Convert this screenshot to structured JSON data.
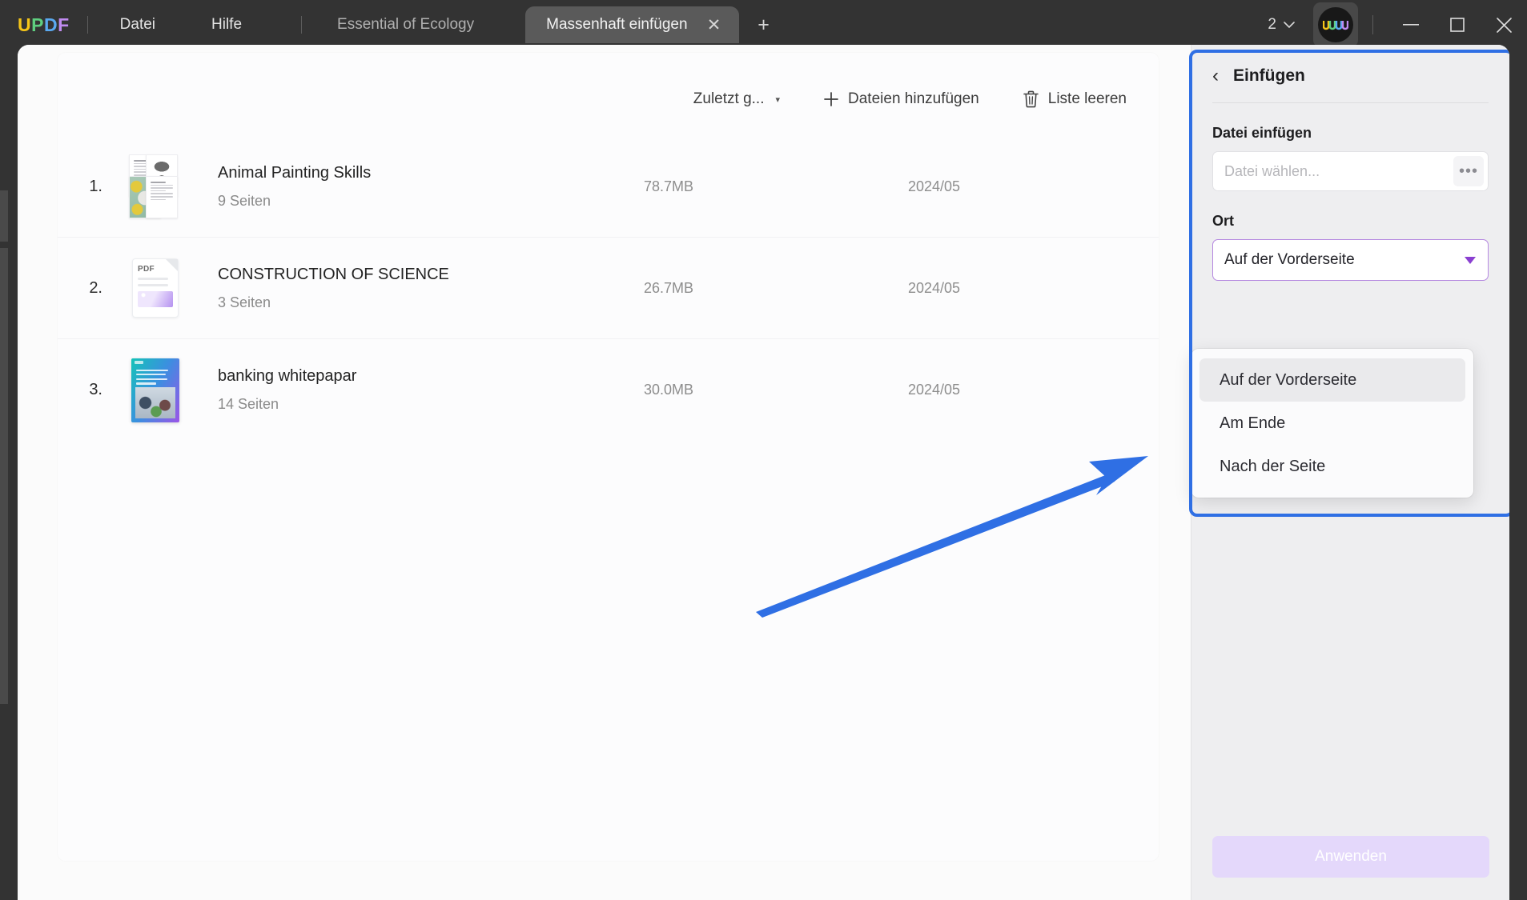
{
  "titlebar": {
    "logo_letters": [
      "U",
      "P",
      "D",
      "F"
    ],
    "menus": [
      {
        "label": "Datei",
        "name": "menu-datei"
      },
      {
        "label": "Hilfe",
        "name": "menu-hilfe"
      }
    ],
    "document_tab_label": "Essential of Ecology",
    "active_tab_label": "Massenhaft einfügen",
    "close_tab_glyph": "✕",
    "new_tab_glyph": "+",
    "page_count": "2",
    "page_count_caret": "⌄",
    "minimize_glyph": "—",
    "maximize_glyph": "□",
    "close_glyph": "✕"
  },
  "toolbar": {
    "sort_label": "Zuletzt g...",
    "sort_caret": "▾",
    "add_files_icon": "+",
    "add_files_label": "Dateien hinzufügen",
    "clear_list_label": "Liste leeren"
  },
  "files": [
    {
      "index": "1.",
      "name": "Animal Painting Skills",
      "pages": "9 Seiten",
      "size": "78.7MB",
      "date": "2024/05",
      "thumb": "page-grid"
    },
    {
      "index": "2.",
      "name": "CONSTRUCTION OF SCIENCE",
      "pages": "3 Seiten",
      "size": "26.7MB",
      "date": "2024/05",
      "thumb": "pdf-icon",
      "pdf_label": "PDF"
    },
    {
      "index": "3.",
      "name": "banking whitepapar",
      "pages": "14 Seiten",
      "size": "30.0MB",
      "date": "2024/05",
      "thumb": "cover-image"
    }
  ],
  "panel": {
    "back_glyph": "‹",
    "title": "Einfügen",
    "file_field_label": "Datei einfügen",
    "file_field_placeholder": "Datei wählen...",
    "file_browse_glyph": "•••",
    "location_label": "Ort",
    "location_value": "Auf der Vorderseite",
    "location_options": [
      {
        "label": "Auf der Vorderseite",
        "selected": true
      },
      {
        "label": "Am Ende",
        "selected": false
      },
      {
        "label": "Nach der Seite",
        "selected": false
      }
    ],
    "apply_label": "Anwenden"
  },
  "colors": {
    "titlebar_bg": "#333333",
    "panel_bg": "#eeeef0",
    "highlight_border": "#2f6fe4",
    "arrow": "#2f6fe4",
    "accent_purple": "#8a3fd1",
    "select_border": "#b588e0",
    "apply_disabled_bg": "#e4d8fb"
  }
}
